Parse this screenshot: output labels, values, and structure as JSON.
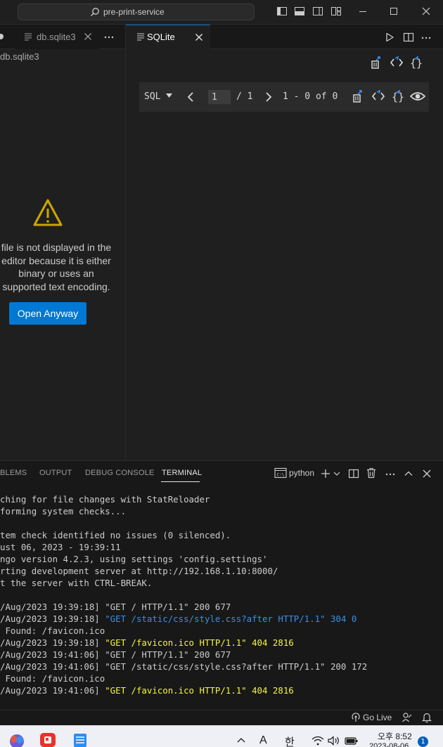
{
  "titlebar": {
    "search_text": "pre-print-service"
  },
  "left_editor": {
    "tab_label": "db.sqlite3",
    "breadcrumb": "db.sqlite3",
    "warning_lines": [
      "file is not displayed in the",
      "editor because it is either",
      "binary or uses an",
      "supported text encoding."
    ],
    "open_anyway_label": "Open Anyway"
  },
  "right_editor": {
    "tab_label": "SQLite",
    "sql_label": "SQL",
    "page_value": "1",
    "page_total": "/ 1",
    "row_range": "1 - 0 of 0"
  },
  "panel": {
    "tabs": [
      "BLEMS",
      "OUTPUT",
      "DEBUG CONSOLE",
      "TERMINAL"
    ],
    "active_tab": "TERMINAL",
    "shell_label": "python",
    "terminal_lines": [
      {
        "text": "ching for file changes with StatReloader"
      },
      {
        "text": "forming system checks..."
      },
      {
        "text": ""
      },
      {
        "text": "tem check identified no issues (0 silenced)."
      },
      {
        "text": "ust 06, 2023 - 19:39:11"
      },
      {
        "text": "ngo version 4.2.3, using settings 'config.settings'"
      },
      {
        "text": "rting development server at http://192.168.1.10:8000/"
      },
      {
        "text": "t the server with CTRL-BREAK."
      },
      {
        "text": ""
      },
      {
        "pre": "/Aug/2023 19:39:18] ",
        "text": "\"GET / HTTP/1.1\" 200 677"
      },
      {
        "pre": "/Aug/2023 19:39:18] ",
        "text": "\"GET /static/css/style.css?after HTTP/1.1\" 304 0",
        "color": "#3b8eea"
      },
      {
        "text": " Found: /favicon.ico"
      },
      {
        "pre": "/Aug/2023 19:39:18] ",
        "text": "\"GET /favicon.ico HTTP/1.1\" 404 2816",
        "color": "#f5f543"
      },
      {
        "pre": "/Aug/2023 19:41:06] ",
        "text": "\"GET / HTTP/1.1\" 200 677"
      },
      {
        "pre": "/Aug/2023 19:41:06] ",
        "text": "\"GET /static/css/style.css?after HTTP/1.1\" 200 172"
      },
      {
        "text": " Found: /favicon.ico"
      },
      {
        "pre": "/Aug/2023 19:41:06] ",
        "text": "\"GET /favicon.ico HTTP/1.1\" 404 2816",
        "color": "#f5f543"
      }
    ]
  },
  "statusbar": {
    "golive_label": "Go Live"
  },
  "taskbar": {
    "ime_letter": "A",
    "ime_lang": "한",
    "time": "오후 8:52",
    "date": "2023-08-06",
    "notification_count": "1"
  },
  "colors": {
    "accent": "#0078d4",
    "warning": "#cca700",
    "link_blue": "#3b8eea",
    "yellow": "#f5f543"
  }
}
